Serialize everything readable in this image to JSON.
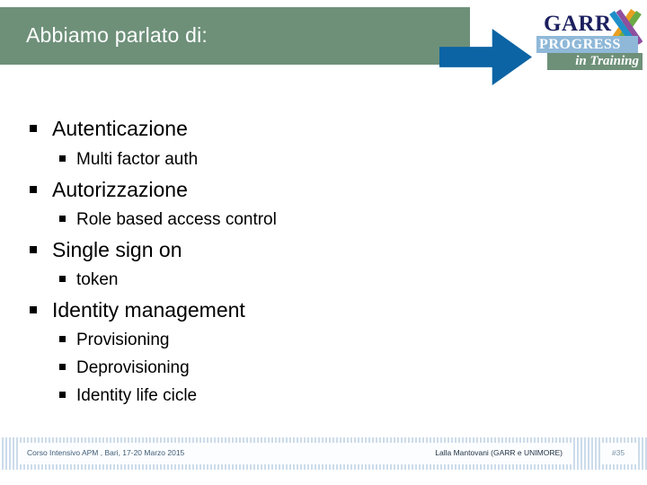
{
  "slide": {
    "title": "Abbiamo parlato di:",
    "colors": {
      "title_band_green": "#6e9079",
      "ribbon_blue": "#0c64a4",
      "logo_navy": "#1b1f5e",
      "logo_progress_band": "#8fb8d8",
      "logo_training_band": "#6e9079",
      "footer_hatch": "#eef4fa",
      "bullet_text": "#000000"
    }
  },
  "logo": {
    "name": "garr-progress-in-training-logo",
    "wordmark": "GARR",
    "x_mark": "X",
    "progress": "PROGRESS",
    "training": "in Training",
    "x_colors": [
      "#e8a020",
      "#6aab45",
      "#1f8fc9",
      "#8e4f9e"
    ]
  },
  "bullets": [
    {
      "level": 1,
      "label": "Autenticazione"
    },
    {
      "level": 2,
      "label": "Multi factor auth"
    },
    {
      "level": 1,
      "label": "Autorizzazione"
    },
    {
      "level": 2,
      "label": "Role based access control"
    },
    {
      "level": 1,
      "label": "Single sign on"
    },
    {
      "level": 2,
      "label": "token"
    },
    {
      "level": 1,
      "label": "Identity management"
    },
    {
      "level": 2,
      "label": "Provisioning"
    },
    {
      "level": 2,
      "label": "Deprovisioning"
    },
    {
      "level": 2,
      "label": "Identity life cicle"
    }
  ],
  "footer": {
    "left": "Corso Intensivo APM , Bari, 17-20 Marzo 2015",
    "right": "Lalla Mantovani (GARR e UNIMORE)",
    "page": "#35"
  }
}
